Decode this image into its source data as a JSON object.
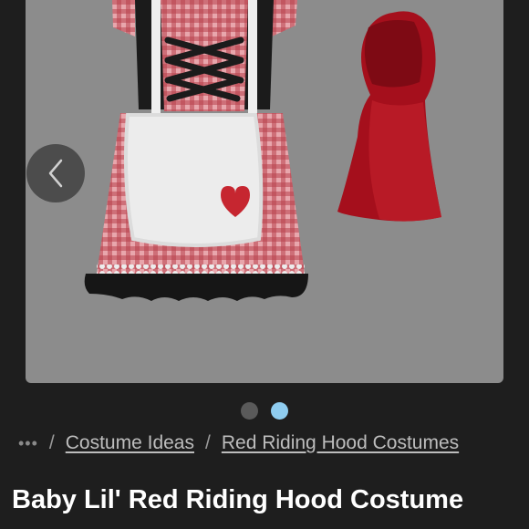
{
  "breadcrumb": {
    "ellipsis": "•••",
    "separator": "/",
    "items": [
      {
        "label": "Costume Ideas"
      },
      {
        "label": "Red Riding Hood Costumes"
      }
    ]
  },
  "product": {
    "title": "Baby Lil' Red Riding Hood Costume"
  },
  "carousel": {
    "total_images": 2,
    "active_index": 1
  },
  "icons": {
    "prev": "chevron-left-icon"
  },
  "colors": {
    "background": "#1e1e1e",
    "active_dot": "#8fcdf0",
    "inactive_dot": "#5a5a5a",
    "image_background": "#8c8c8c"
  }
}
